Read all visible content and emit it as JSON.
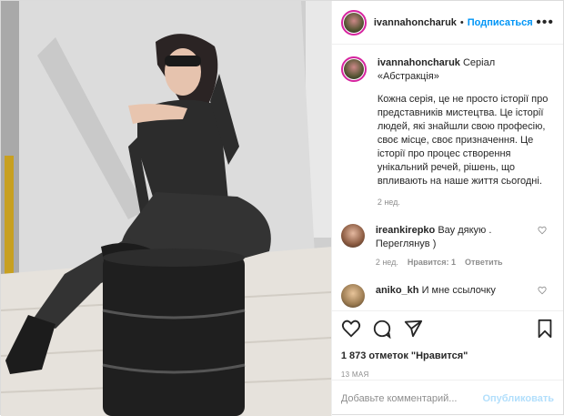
{
  "post": {
    "username": "ivannahoncharuk",
    "follow_label": "Подписаться",
    "dot": "•",
    "more": "•••"
  },
  "caption": {
    "username": "ivannahoncharuk",
    "title": "Серіал «Абстракція»",
    "text": "Кожна серія, це не просто історії про представників мистецтва. Це історії людей, які знайшли свою професію, своє місце, своє призначення. Це історії про процес створення унікальний речей, рішень, що впливають на наше життя сьогодні.",
    "time": "2 нед."
  },
  "comments": [
    {
      "username": "ireankirepko",
      "text": "Вау дякую . Переглянув )",
      "time": "2 нед.",
      "likes_label": "Нравится: 1",
      "reply_label": "Ответить"
    },
    {
      "username": "aniko_kh",
      "text": "И мне ссылочку",
      "time": "",
      "likes_label": "",
      "reply_label": ""
    }
  ],
  "likes": "1 873 отметок \"Нравится\"",
  "date": "13 МАЯ",
  "add_comment": {
    "placeholder": "Добавьте комментарий...",
    "publish_label": "Опубликовать"
  },
  "colors": {
    "accent": "#0095f6",
    "publish_disabled": "#b2dffc",
    "meta": "#8e8e8e"
  }
}
